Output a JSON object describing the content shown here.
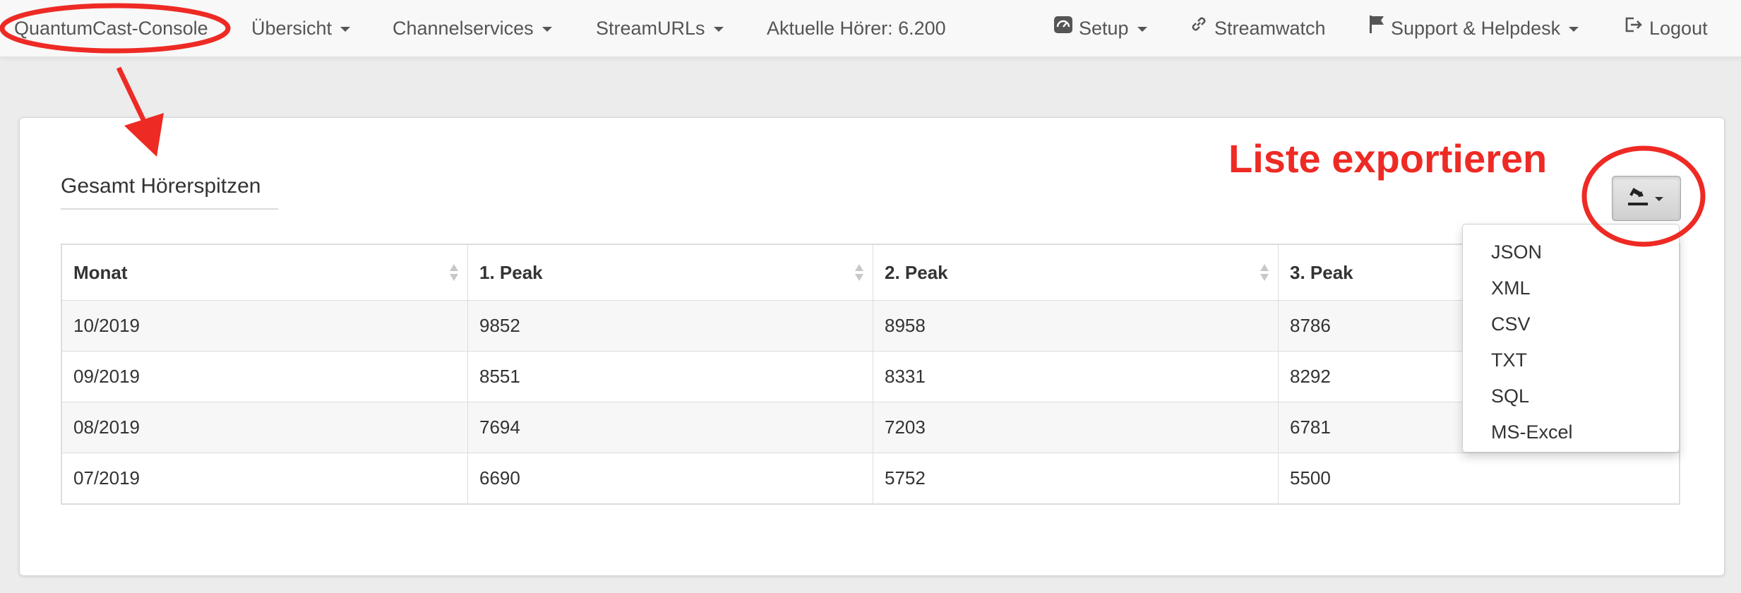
{
  "navbar": {
    "brand": "QuantumCast-Console",
    "items_left": [
      {
        "label": "Übersicht",
        "dropdown": true
      },
      {
        "label": "Channelservices",
        "dropdown": true
      },
      {
        "label": "StreamURLs",
        "dropdown": true
      }
    ],
    "listeners": "Aktuelle Hörer: 6.200",
    "items_right": [
      {
        "label": "Setup",
        "icon": "gauge-icon",
        "dropdown": true
      },
      {
        "label": "Streamwatch",
        "icon": "link-icon",
        "dropdown": false
      },
      {
        "label": "Support & Helpdesk",
        "icon": "flag-icon",
        "dropdown": true
      },
      {
        "label": "Logout",
        "icon": "logout-icon",
        "dropdown": false
      }
    ]
  },
  "panel": {
    "title": "Gesamt Hörerspitzen"
  },
  "table": {
    "columns": [
      "Monat",
      "1. Peak",
      "2. Peak",
      "3. Peak"
    ],
    "rows": [
      [
        "10/2019",
        "9852",
        "8958",
        "8786"
      ],
      [
        "09/2019",
        "8551",
        "8331",
        "8292"
      ],
      [
        "08/2019",
        "7694",
        "7203",
        "6781"
      ],
      [
        "07/2019",
        "6690",
        "5752",
        "5500"
      ]
    ]
  },
  "export": {
    "icon": "export-icon",
    "options": [
      "JSON",
      "XML",
      "CSV",
      "TXT",
      "SQL",
      "MS-Excel"
    ]
  },
  "annotation": {
    "text": "Liste exportieren",
    "color": "#ee2a24"
  }
}
